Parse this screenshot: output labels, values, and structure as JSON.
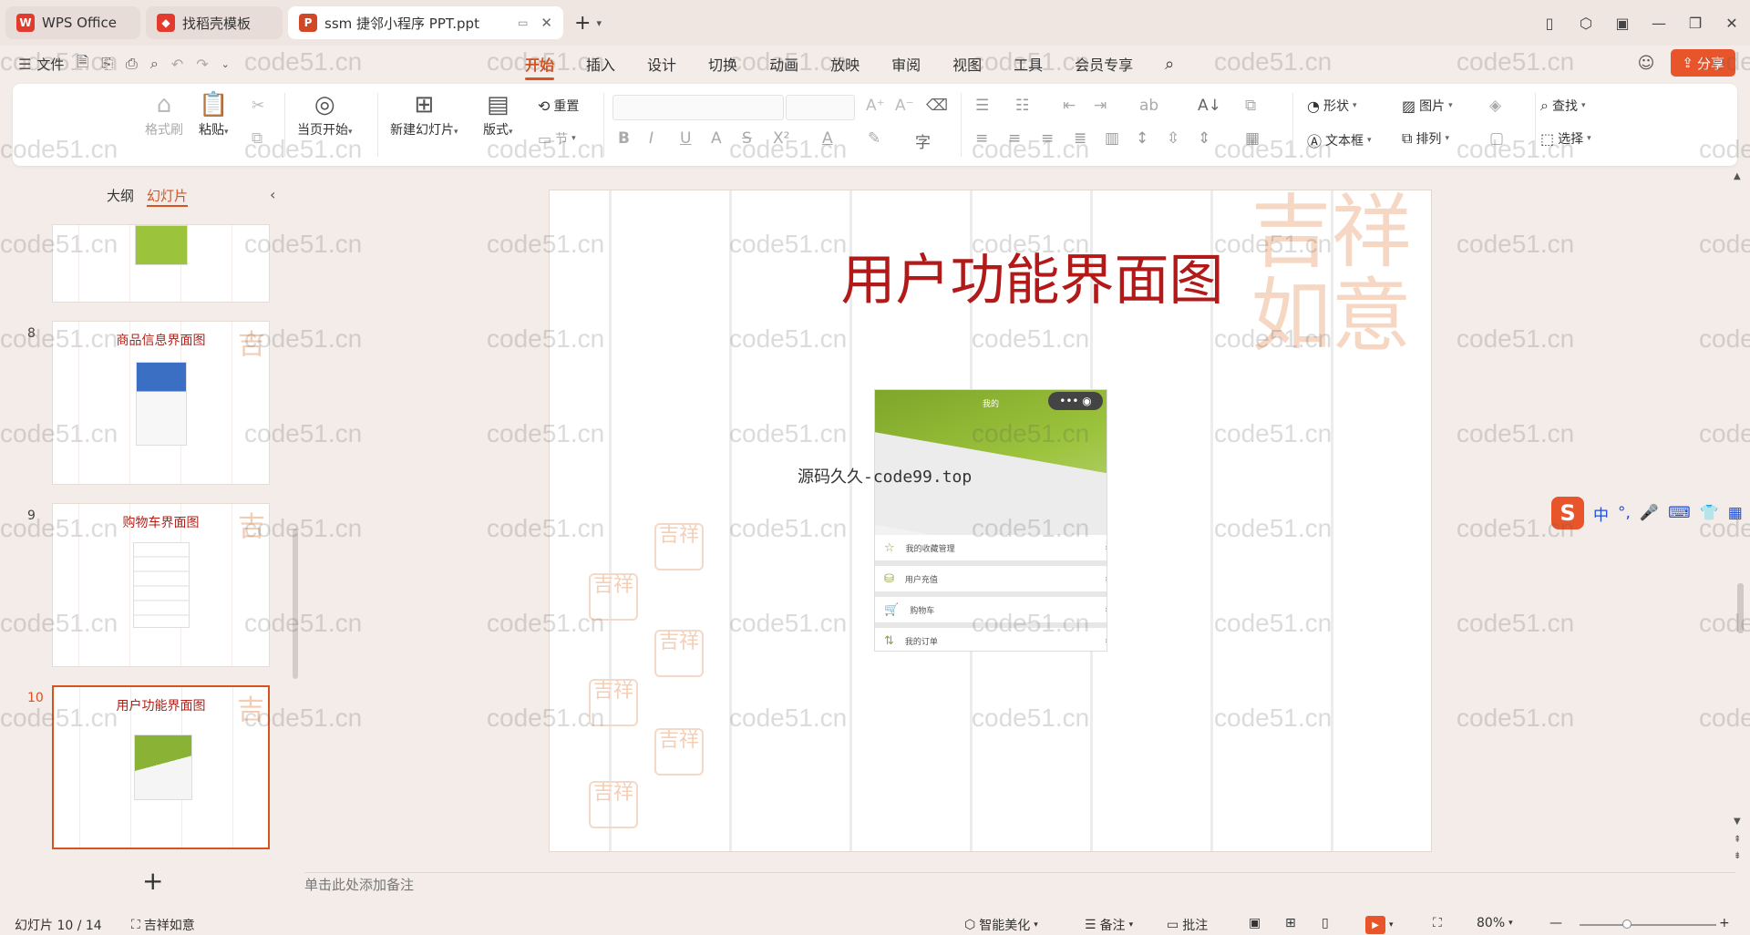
{
  "titlebar": {
    "tabs": [
      {
        "label": "WPS Office",
        "logo": "W",
        "color": "#e23b2e"
      },
      {
        "label": "找稻壳模板",
        "logo": "稻",
        "color": "#e23b2e"
      },
      {
        "label": "ssm 捷邻小程序 PPT.ppt",
        "logo": "P",
        "color": "#d24726"
      }
    ]
  },
  "menu": {
    "file_label": "文件",
    "tabs": [
      "开始",
      "插入",
      "设计",
      "切换",
      "动画",
      "放映",
      "审阅",
      "视图",
      "工具",
      "会员专享"
    ],
    "share_label": "分享"
  },
  "ribbon": {
    "format_painter": "格式刷",
    "paste": "粘贴",
    "start_from_current": "当页开始",
    "new_slide": "新建幻灯片",
    "layout": "版式",
    "reset": "重置",
    "section": "节",
    "shape": "形状",
    "picture": "图片",
    "textbox": "文本框",
    "arrange": "排列",
    "find": "查找",
    "select": "选择"
  },
  "side": {
    "outline_tab": "大纲",
    "slides_tab": "幻灯片",
    "thumbs": [
      {
        "num": "",
        "title": ""
      },
      {
        "num": "8",
        "title": "商品信息界面图"
      },
      {
        "num": "9",
        "title": "购物车界面图"
      },
      {
        "num": "10",
        "title": "用户功能界面图"
      }
    ]
  },
  "slide": {
    "title": "用户功能界面图",
    "stamp_text": "吉祥如意",
    "caption": "源码久久-code99.top",
    "phone": {
      "header": "我的",
      "rows": [
        "我的收藏管理",
        "用户充值",
        "购物车",
        "我的订单"
      ]
    }
  },
  "notes": {
    "placeholder": "单击此处添加备注"
  },
  "status": {
    "slide_counter": "幻灯片 10 / 14",
    "theme": "吉祥如意",
    "beautify": "智能美化",
    "notes": "备注",
    "comments": "批注",
    "zoom": "80%"
  },
  "ime": {
    "mode": "中"
  },
  "watermark": "code51.cn"
}
